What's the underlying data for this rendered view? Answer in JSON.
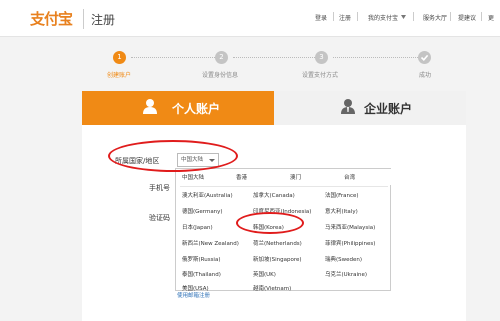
{
  "header": {
    "logo_text": "支付宝",
    "page_title": "注册",
    "nav": [
      "登录",
      "注册",
      "我的支付宝",
      "服务大厅",
      "提建议",
      "更"
    ]
  },
  "steps": [
    {
      "number": "1",
      "label": "创建账户",
      "active": true
    },
    {
      "number": "2",
      "label": "设置身份信息",
      "active": false
    },
    {
      "number": "3",
      "label": "设置支付方式",
      "active": false
    },
    {
      "number": "",
      "label": "成功",
      "active": false
    }
  ],
  "tabs": {
    "personal": "个人账户",
    "corporate": "企业账户"
  },
  "form": {
    "country_label": "所属国家/地区",
    "country_value": "中国大陆",
    "phone_label": "手机号",
    "code_label": "验证码"
  },
  "dropdown": {
    "regions": [
      "中国大陆",
      "香港",
      "澳门",
      "台湾"
    ],
    "countries": [
      [
        "澳大利亚(Australia)",
        "加拿大(Canada)",
        "法国(France)"
      ],
      [
        "德国(Germany)",
        "印度尼西亚(Indonesia)",
        "意大利(Italy)"
      ],
      [
        "日本(Japan)",
        "韩国(Korea)",
        "马来西亚(Malaysia)"
      ],
      [
        "新西兰(New Zealand)",
        "荷兰(Netherlands)",
        "菲律宾(Philippines)"
      ],
      [
        "俄罗斯(Russia)",
        "新加坡(Singapore)",
        "瑞典(Sweden)"
      ],
      [
        "泰国(Thailand)",
        "英国(UK)",
        "乌克兰(Ukraine)"
      ],
      [
        "美国(USA)",
        "越南(Vietnam)",
        ""
      ]
    ]
  },
  "mail_link": "使用邮箱注册",
  "colors": {
    "accent": "#f08a15",
    "annotation": "#e01c1c",
    "link": "#2b6fb6"
  }
}
